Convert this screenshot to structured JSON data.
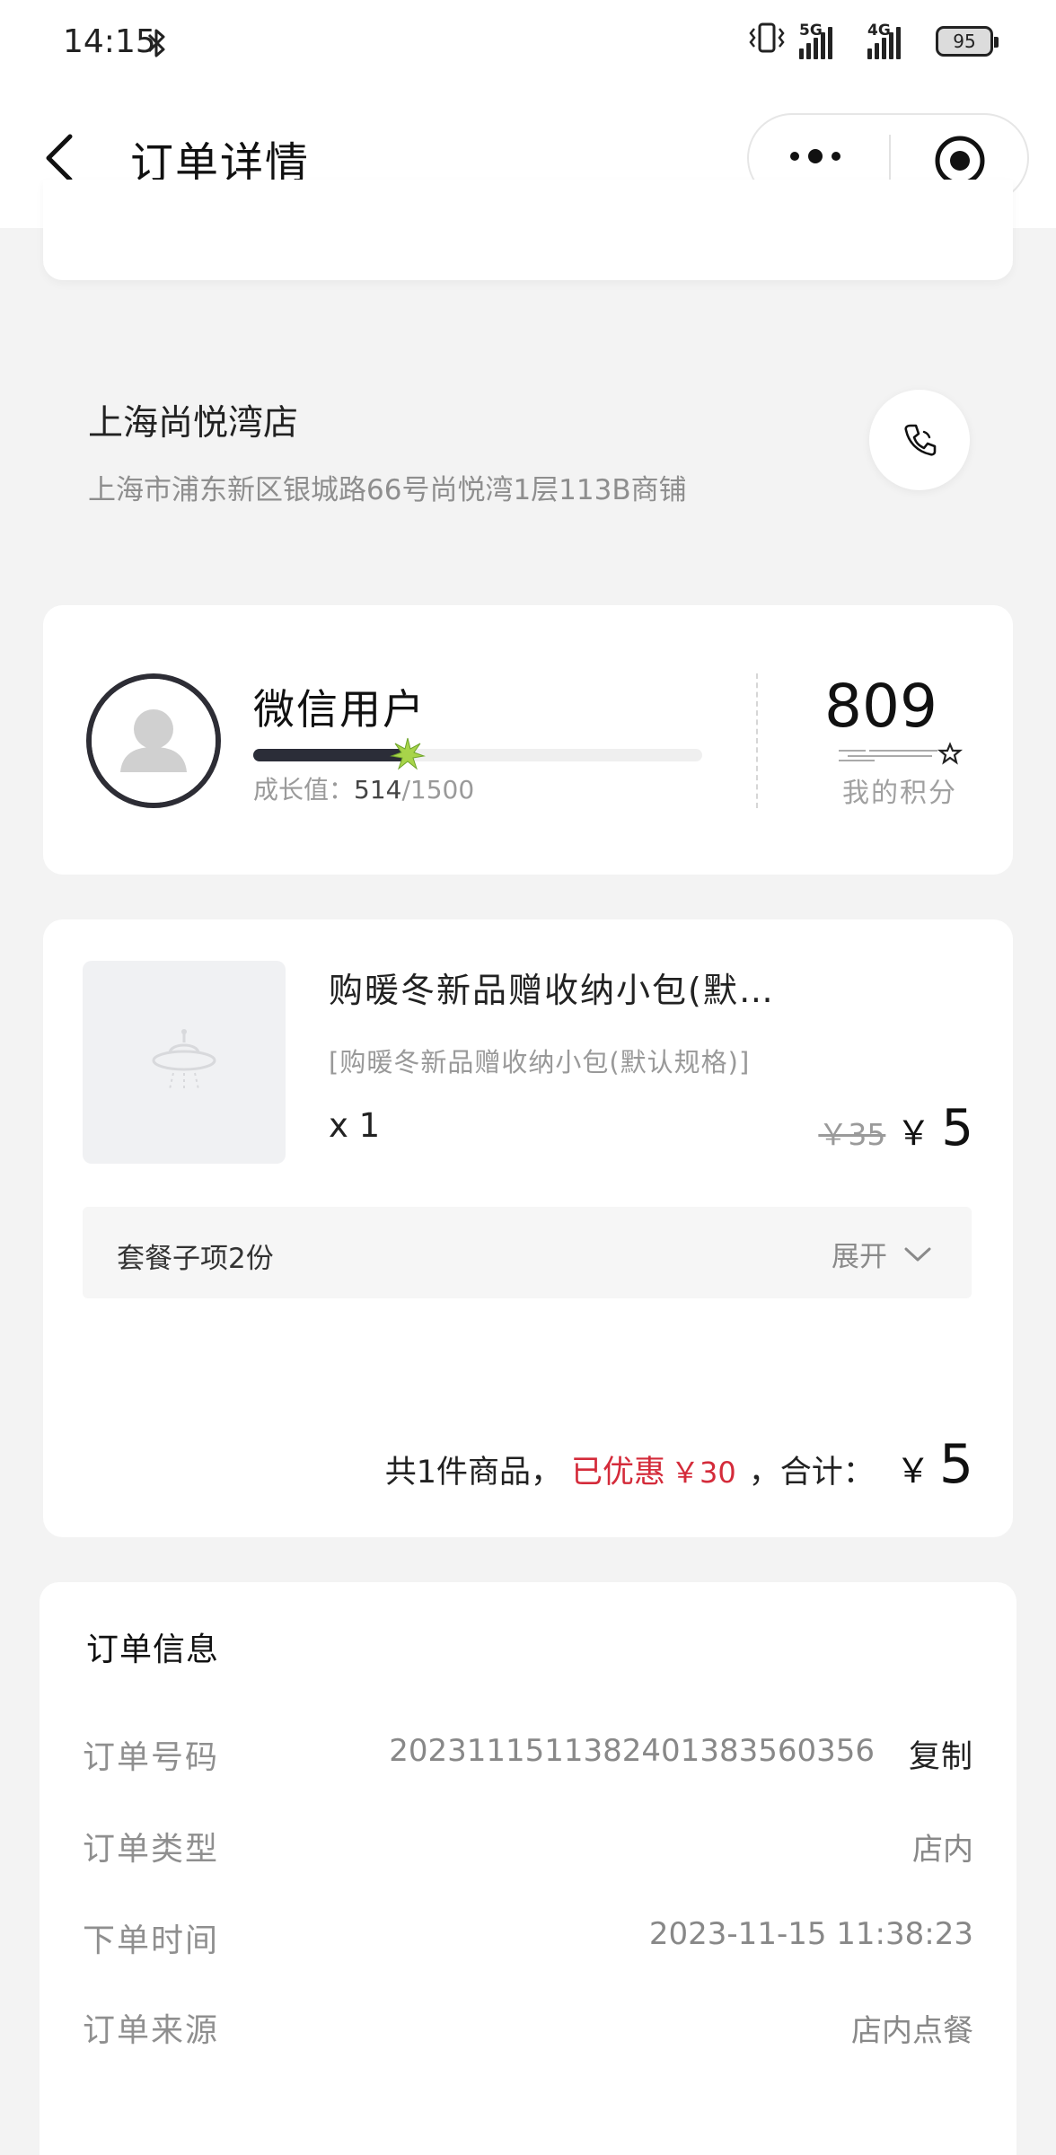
{
  "status_bar": {
    "time": "14:15",
    "network_1": "5G",
    "network_2": "4G",
    "battery": "95"
  },
  "nav": {
    "title": "订单详情"
  },
  "store": {
    "name": "上海尚悦湾店",
    "address": "上海市浦东新区银城路66号尚悦湾1层113B商铺"
  },
  "member": {
    "name": "微信用户",
    "growth_label": "成长值：",
    "growth_current": "514",
    "growth_max": "/1500",
    "growth_progress": 0.343,
    "points": "809",
    "points_label": "我的积分"
  },
  "product": {
    "name": "购暖冬新品赠收纳小包(默…",
    "spec": "[购暖冬新品赠收纳小包(默认规格)]",
    "quantity": "x 1",
    "original_price": "￥35",
    "currency": "￥",
    "price": "5",
    "combo_label": "套餐子项2份",
    "expand_label": "展开"
  },
  "summary": {
    "count_text": "共1件商品，",
    "discount_label": "已优惠",
    "discount_amount": "￥30",
    "total_label": "，合计：",
    "currency": "￥",
    "total": "5"
  },
  "order_info": {
    "title": "订单信息",
    "copy_label": "复制",
    "rows": [
      {
        "label": "订单号码",
        "value": "2023111511382401383560356"
      },
      {
        "label": "订单类型",
        "value": "店内"
      },
      {
        "label": "下单时间",
        "value": "2023-11-15 11:38:23"
      },
      {
        "label": "订单来源",
        "value": "店内点餐"
      }
    ]
  },
  "colors": {
    "accent_red": "#d42b3a",
    "progress_dark": "#2b2d38",
    "star_green": "#a8d44a"
  }
}
